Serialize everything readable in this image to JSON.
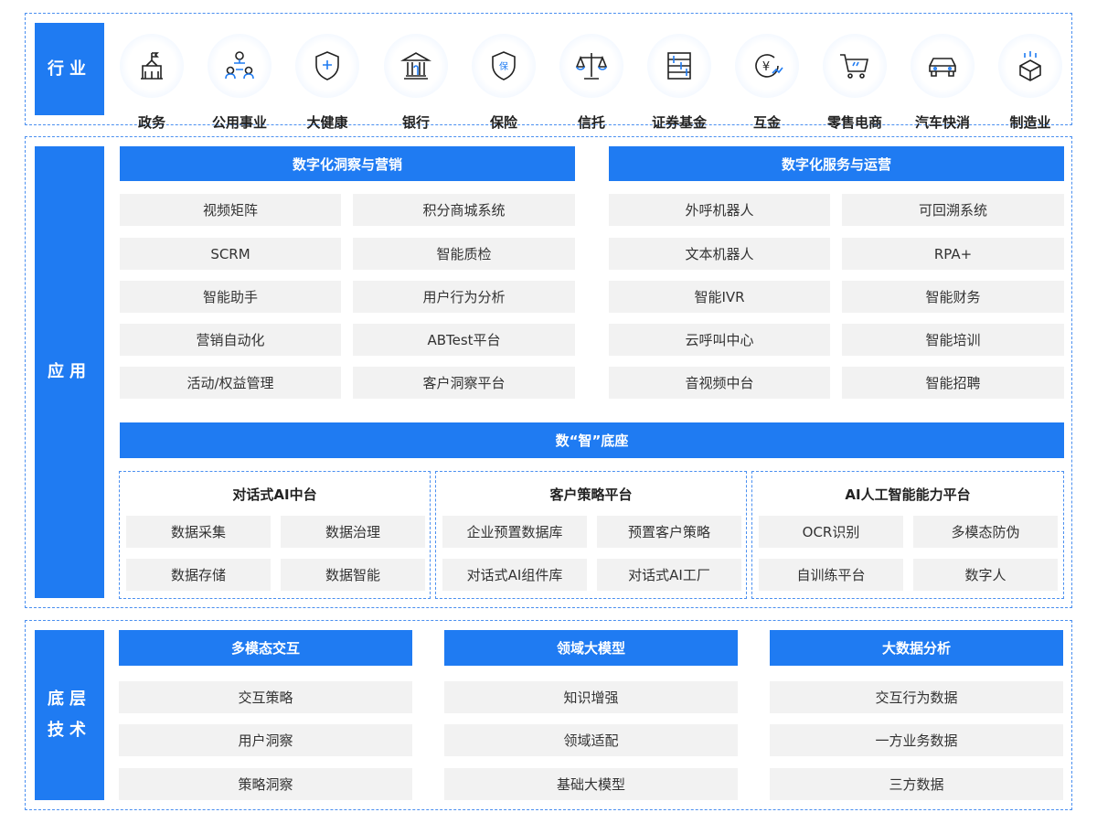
{
  "industry": {
    "side_label": "行业",
    "items": [
      {
        "label": "政务",
        "icon": "government-building-icon"
      },
      {
        "label": "公用事业",
        "icon": "people-network-icon"
      },
      {
        "label": "大健康",
        "icon": "health-shield-icon"
      },
      {
        "label": "银行",
        "icon": "bank-icon"
      },
      {
        "label": "保险",
        "icon": "insurance-shield-icon"
      },
      {
        "label": "信托",
        "icon": "scale-icon"
      },
      {
        "label": "证券基金",
        "icon": "chart-board-icon"
      },
      {
        "label": "互金",
        "icon": "yen-coin-icon"
      },
      {
        "label": "零售电商",
        "icon": "shopping-cart-icon"
      },
      {
        "label": "汽车快消",
        "icon": "car-icon"
      },
      {
        "label": "制造业",
        "icon": "cube-icon"
      }
    ]
  },
  "application": {
    "side_label": "应用",
    "insight": {
      "title": "数字化洞察与营销",
      "items": [
        "视频矩阵",
        "积分商城系统",
        "SCRM",
        "智能质检",
        "智能助手",
        "用户行为分析",
        "营销自动化",
        "ABTest平台",
        "活动/权益管理",
        "客户洞察平台"
      ]
    },
    "service": {
      "title": "数字化服务与运营",
      "items": [
        "外呼机器人",
        "可回溯系统",
        "文本机器人",
        "RPA+",
        "智能IVR",
        "智能财务",
        "云呼叫中心",
        "智能培训",
        "音视频中台",
        "智能招聘"
      ]
    },
    "base_title": "数“智”底座",
    "platforms": [
      {
        "title": "对话式AI中台",
        "items": [
          "数据采集",
          "数据治理",
          "数据存储",
          "数据智能"
        ]
      },
      {
        "title": "客户策略平台",
        "items": [
          "企业预置数据库",
          "预置客户策略",
          "对话式AI组件库",
          "对话式AI工厂"
        ]
      },
      {
        "title": "AI人工智能能力平台",
        "items": [
          "OCR识别",
          "多模态防伪",
          "自训练平台",
          "数字人"
        ]
      }
    ]
  },
  "tech": {
    "side_label": "底层技术",
    "columns": [
      {
        "title": "多模态交互",
        "items": [
          "交互策略",
          "用户洞察",
          "策略洞察"
        ]
      },
      {
        "title": "领域大模型",
        "items": [
          "知识增强",
          "领域适配",
          "基础大模型"
        ]
      },
      {
        "title": "大数据分析",
        "items": [
          "交互行为数据",
          "一方业务数据",
          "三方数据"
        ]
      }
    ]
  },
  "colors": {
    "accent": "#1f7bf2",
    "cell_bg": "#f2f2f2",
    "icon_bg": "#e4efff"
  }
}
